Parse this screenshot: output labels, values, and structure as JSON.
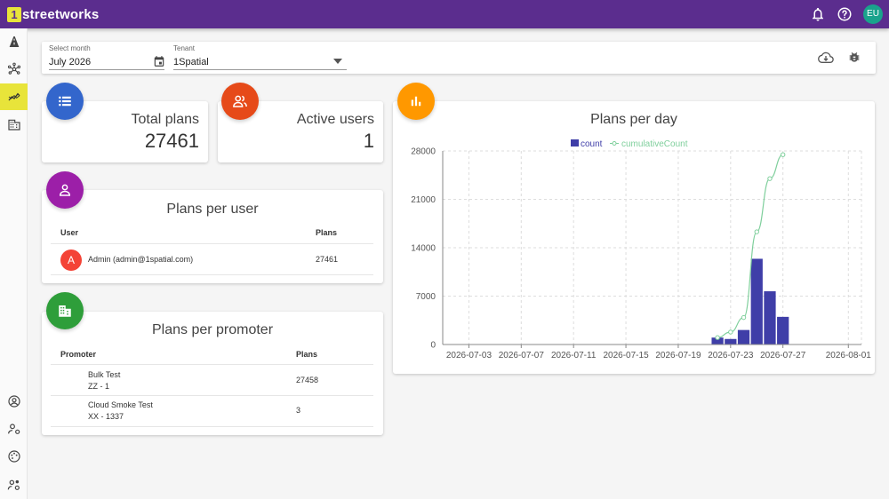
{
  "app": {
    "logo_mark": "1",
    "logo_text": "streetworks",
    "user_initials": "EU",
    "icons": [
      "bell-icon",
      "help-icon"
    ],
    "brand_color": "#5b2d8e",
    "accent_color": "#e8e43a"
  },
  "sidebar": {
    "items": [
      {
        "icon": "road-icon",
        "active": false
      },
      {
        "icon": "network-icon",
        "active": false
      },
      {
        "icon": "analytics-icon",
        "active": true
      },
      {
        "icon": "building-icon",
        "active": false
      },
      {
        "icon": "user-circle-icon",
        "active": false
      },
      {
        "icon": "user-settings-icon",
        "active": false
      },
      {
        "icon": "palette-icon",
        "active": false
      },
      {
        "icon": "user-group-settings-icon",
        "active": false
      }
    ]
  },
  "filters": {
    "month_label": "Select month",
    "month_value": "July 2026",
    "tenant_label": "Tenant",
    "tenant_value": "1Spatial",
    "action_icons": [
      "cloud-download-icon",
      "bug-icon"
    ]
  },
  "total_plans": {
    "title": "Total plans",
    "value": "27461",
    "icon_color": "#3366cc"
  },
  "active_users": {
    "title": "Active users",
    "value": "1",
    "icon_color": "#e64a19"
  },
  "plans_per_user": {
    "title": "Plans per user",
    "icon_color": "#9c1fa8",
    "columns": [
      "User",
      "Plans"
    ],
    "rows": [
      {
        "avatar": "A",
        "user": "Admin (admin@1spatial.com)",
        "plans": "27461"
      }
    ]
  },
  "plans_per_promoter": {
    "title": "Plans per promoter",
    "icon_color": "#2e9e3a",
    "columns": [
      "Promoter",
      "Plans"
    ],
    "rows": [
      {
        "name": "Bulk Test",
        "code": "ZZ - 1",
        "plans": "27458"
      },
      {
        "name": "Cloud Smoke Test",
        "code": "XX - 1337",
        "plans": "3"
      }
    ]
  },
  "plans_per_day": {
    "title": "Plans per day",
    "icon_color": "#ff9800"
  },
  "chart_data": {
    "type": "bar",
    "title": "Plans per day",
    "legend": [
      "count",
      "cumulativeCount"
    ],
    "legend_position": "top-center",
    "grid": true,
    "ylim": [
      0,
      28000
    ],
    "yticks": [
      "0",
      "7000",
      "14000",
      "21000",
      "28000"
    ],
    "xticks": [
      "2026-07-03",
      "2026-07-07",
      "2026-07-11",
      "2026-07-15",
      "2026-07-19",
      "2026-07-23",
      "2026-07-27",
      "2026-08-01"
    ],
    "series": [
      {
        "name": "count",
        "type": "bar",
        "color": "#3f3ea8",
        "x": [
          "2026-07-22",
          "2026-07-23",
          "2026-07-24",
          "2026-07-25",
          "2026-07-26",
          "2026-07-27"
        ],
        "values": [
          1000,
          800,
          2100,
          12400,
          7700,
          4000
        ]
      },
      {
        "name": "cumulativeCount",
        "type": "line",
        "color": "#7fcf9c",
        "x": [
          "2026-07-22",
          "2026-07-23",
          "2026-07-24",
          "2026-07-25",
          "2026-07-26",
          "2026-07-27"
        ],
        "values": [
          1000,
          1800,
          3900,
          16300,
          24000,
          27461
        ]
      }
    ]
  }
}
